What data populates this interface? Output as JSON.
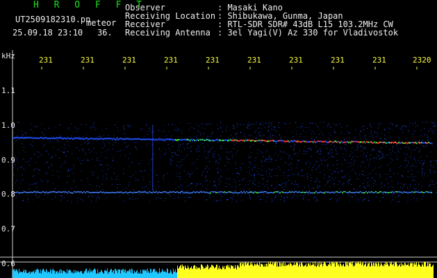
{
  "header": {
    "brand": "H R O F F T",
    "filename": "UT2509182310.pn",
    "tag": "meteor",
    "datetime": "25.09.18 23:10",
    "frame": "36.",
    "fields": [
      {
        "label": "Observer",
        "value": ": Masaki Kano"
      },
      {
        "label": "Receiving Location",
        "value": ": Shibukawa, Gunma, Japan"
      },
      {
        "label": "Receiver",
        "value": ": RTL-SDR SDR# 43dB L15 103.2MHz CW"
      },
      {
        "label": "Receiving Antenna",
        "value": ": 3el Yagi(V) Az 330 for Vladivostok"
      }
    ]
  },
  "axis": {
    "unit": "kHz",
    "y_ticks": [
      "1.1",
      "1.0",
      "0.9",
      "0.8",
      "0.7",
      "0.6"
    ],
    "x_ticks": [
      "231",
      "231",
      "231",
      "231",
      "231",
      "231",
      "231",
      "231",
      "231",
      "2320"
    ]
  },
  "colors": {
    "bg": "#000000",
    "header_text": "#f0f0f0",
    "brand": "#19e619",
    "tick_text": "#ffff40",
    "signal_hot": "#ff3030",
    "signal_mid": "#40ff40",
    "noise": "#2050ff",
    "level_cyan": "#20c8ff",
    "level_yellow": "#ffff20"
  }
}
